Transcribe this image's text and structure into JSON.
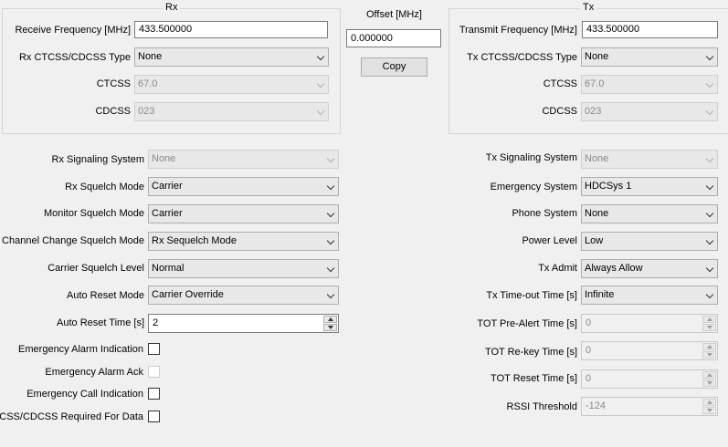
{
  "rx": {
    "title": "Rx",
    "freq_label": "Receive Frequency [MHz]",
    "freq_value": "433.500000",
    "ctcss_type_label": "Rx CTCSS/CDCSS Type",
    "ctcss_type_value": "None",
    "ctcss_label": "CTCSS",
    "ctcss_value": "67.0",
    "cdcss_label": "CDCSS",
    "cdcss_value": "023"
  },
  "offset": {
    "label": "Offset [MHz]",
    "value": "0.000000",
    "copy_label": "Copy"
  },
  "tx": {
    "title": "Tx",
    "freq_label": "Transmit Frequency [MHz]",
    "freq_value": "433.500000",
    "ctcss_type_label": "Tx CTCSS/CDCSS Type",
    "ctcss_type_value": "None",
    "ctcss_label": "CTCSS",
    "ctcss_value": "67.0",
    "cdcss_label": "CDCSS",
    "cdcss_value": "023"
  },
  "left": {
    "rx_signaling_label": "Rx Signaling System",
    "rx_signaling_value": "None",
    "rx_squelch_label": "Rx Squelch Mode",
    "rx_squelch_value": "Carrier",
    "monitor_squelch_label": "Monitor Squelch Mode",
    "monitor_squelch_value": "Carrier",
    "channel_change_label": "Channel Change Squelch Mode",
    "channel_change_value": "Rx Sequelch Mode",
    "carrier_level_label": "Carrier Squelch Level",
    "carrier_level_value": "Normal",
    "auto_reset_mode_label": "Auto Reset Mode",
    "auto_reset_mode_value": "Carrier Override",
    "auto_reset_time_label": "Auto Reset Time [s]",
    "auto_reset_time_value": "2",
    "emerg_alarm_ind_label": "Emergency Alarm Indication",
    "emerg_alarm_ack_label": "Emergency Alarm Ack",
    "emerg_call_ind_label": "Emergency Call Indication",
    "ctcss_required_label": "CTCSS/CDCSS Required For Data"
  },
  "right": {
    "tx_signaling_label": "Tx Signaling System",
    "tx_signaling_value": "None",
    "emergency_system_label": "Emergency System",
    "emergency_system_value": "HDCSys 1",
    "phone_system_label": "Phone System",
    "phone_system_value": "None",
    "power_level_label": "Power Level",
    "power_level_value": "Low",
    "tx_admit_label": "Tx Admit",
    "tx_admit_value": "Always Allow",
    "tx_timeout_label": "Tx Time-out Time [s]",
    "tx_timeout_value": "Infinite",
    "tot_prealert_label": "TOT Pre-Alert Time [s]",
    "tot_prealert_value": "0",
    "tot_rekey_label": "TOT Re-key Time [s]",
    "tot_rekey_value": "0",
    "tot_reset_label": "TOT Reset Time [s]",
    "tot_reset_value": "0",
    "rssi_label": "RSSI Threshold",
    "rssi_value": "-124"
  }
}
